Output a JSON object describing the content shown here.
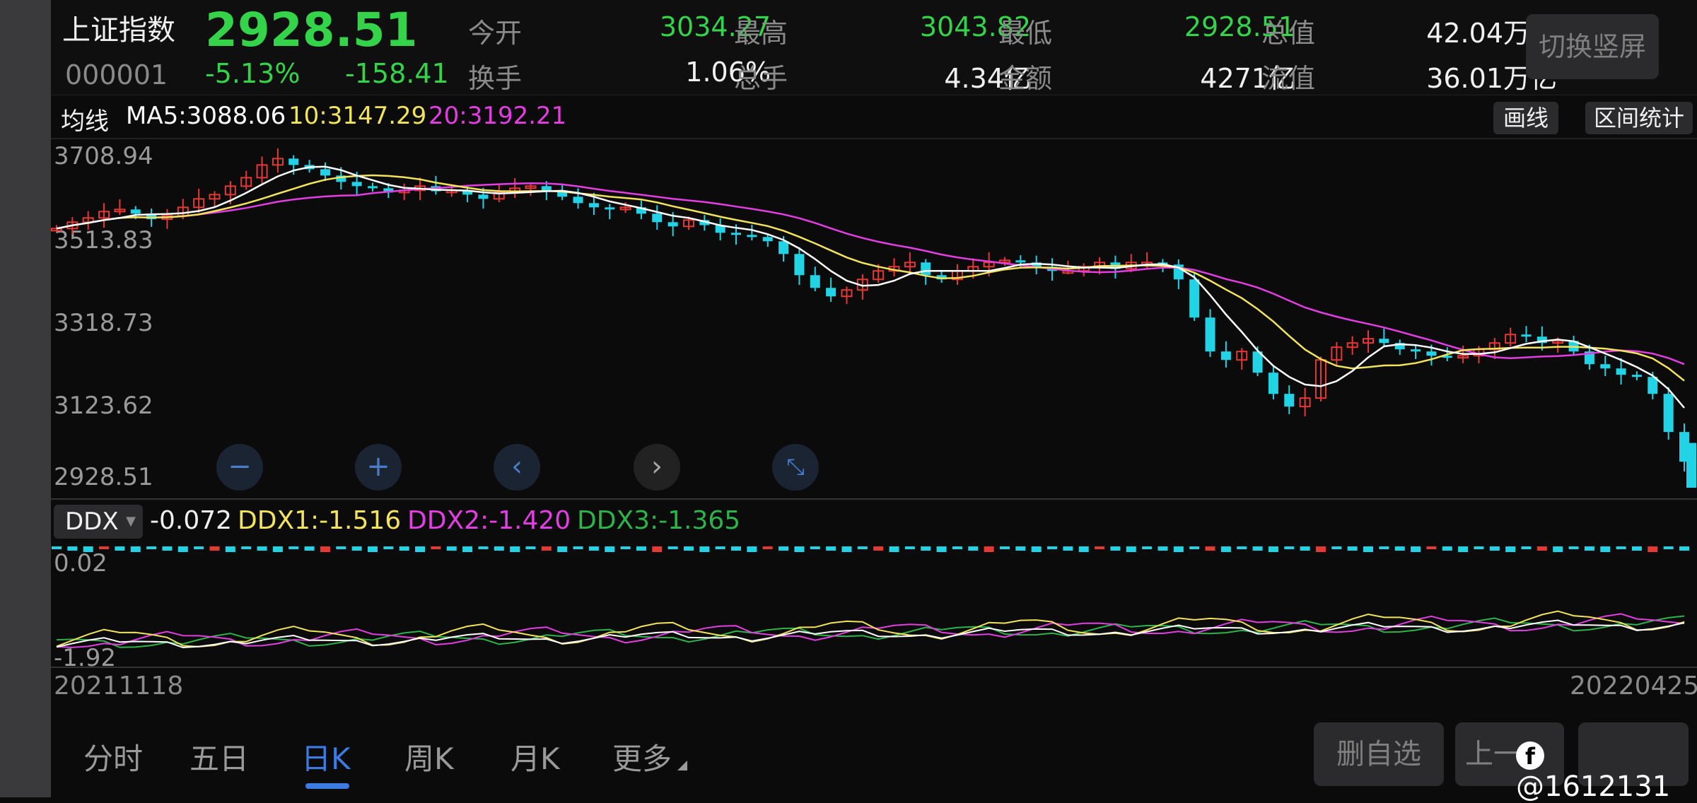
{
  "header": {
    "name": "上证指数",
    "price": "2928.51",
    "code": "000001",
    "change_pct": "-5.13%",
    "change_val": "-158.41",
    "stats": {
      "open_label": "今开",
      "open": "3034.27",
      "high_label": "最高",
      "high": "3043.82",
      "low_label": "最低",
      "low": "2928.51",
      "mktcap_label": "总值",
      "mktcap": "42.04万亿",
      "turnover_label": "换手",
      "turnover": "1.06%",
      "volume_label": "总手",
      "volume": "4.34亿",
      "amount_label": "金额",
      "amount": "4271亿",
      "float_label": "流值",
      "float": "36.01万亿"
    },
    "switch_button": "切换竖屏"
  },
  "ma_bar": {
    "label": "均线",
    "ma5": "MA5:3088.06",
    "ma10": "10:3147.29",
    "ma20": "20:3192.21",
    "draw_button": "画线",
    "range_stats_button": "区间统计"
  },
  "colors": {
    "up": "#e53935",
    "down": "#22d3e6",
    "ma5": "#ffffff",
    "ma10": "#f2e35c",
    "ma20": "#e23ee2",
    "ddx1": "#f2e35c",
    "ddx2": "#e23ee2",
    "ddx3": "#2db34a",
    "price_down": "#35d34a",
    "accent": "#3d7be0"
  },
  "price_axis": [
    "3708.94",
    "3513.83",
    "3318.73",
    "3123.62",
    "2928.51"
  ],
  "zoom_controls": [
    "minus-icon",
    "plus-icon",
    "chevron-left-icon",
    "chevron-right-icon",
    "collapse-icon"
  ],
  "ddx": {
    "selector": "DDX",
    "value": "-0.072",
    "ddx1": "DDX1:-1.516",
    "ddx2": "DDX2:-1.420",
    "ddx3": "DDX3:-1.365",
    "axis_top": "0.02",
    "axis_bottom": "-1.92"
  },
  "dates": {
    "start": "20211118",
    "end": "20220425"
  },
  "tabs": [
    "分时",
    "五日",
    "日K",
    "周K",
    "月K",
    "更多"
  ],
  "active_tab": "日K",
  "bottom_buttons": {
    "delete_watch": "删自选",
    "prev": "上一"
  },
  "watermark": "@1612131",
  "chart_data": {
    "type": "candlestick",
    "x_range": [
      "20211118",
      "20220425"
    ],
    "ylim": [
      2928.51,
      3708.94
    ],
    "y_ticks": [
      3708.94,
      3513.83,
      3318.73,
      3123.62,
      2928.51
    ],
    "ma_lines": [
      "MA5",
      "MA10",
      "MA20"
    ],
    "last_candle": {
      "open": 3034.27,
      "high": 3043.82,
      "low": 2928.51,
      "close": 2928.51
    }
  }
}
